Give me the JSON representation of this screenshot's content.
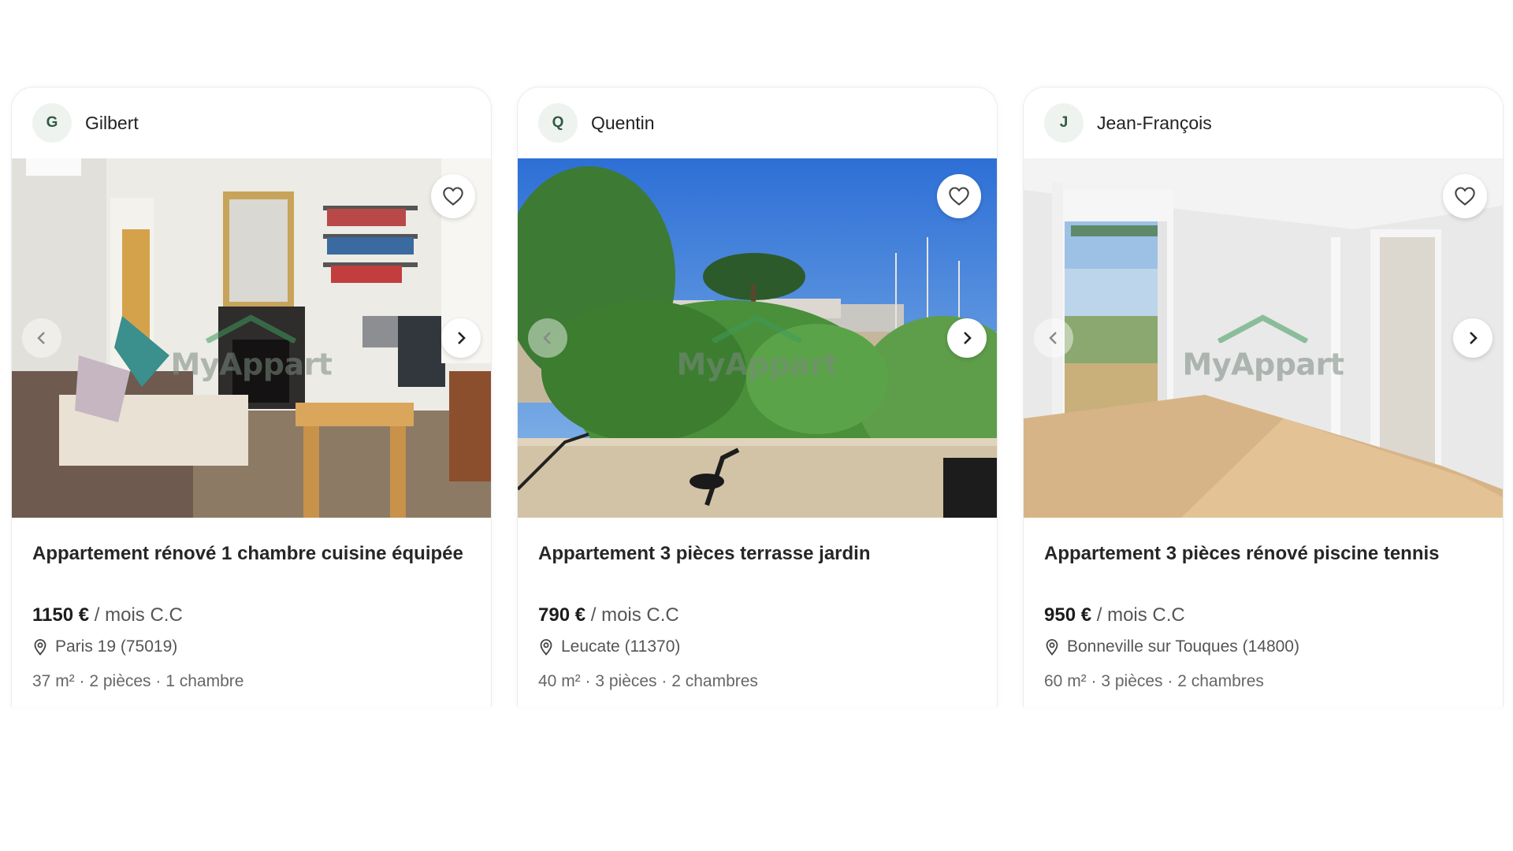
{
  "listings": [
    {
      "owner_initial": "G",
      "owner_name": "Gilbert",
      "title": "Appartement rénové 1 chambre cuisine équipée",
      "price": "1150 €",
      "price_suffix": "/ mois C.C",
      "location": "Paris 19 (75019)",
      "specs": "37 m² · 2 pièces · 1 chambre",
      "watermark": "MyAppart"
    },
    {
      "owner_initial": "Q",
      "owner_name": "Quentin",
      "title": "Appartement 3 pièces terrasse jardin",
      "price": "790 €",
      "price_suffix": "/ mois C.C",
      "location": "Leucate (11370)",
      "specs": "40 m² · 3 pièces · 2 chambres",
      "watermark": "MyAppart"
    },
    {
      "owner_initial": "J",
      "owner_name": "Jean-François",
      "title": "Appartement 3 pièces rénové piscine tennis",
      "price": "950 €",
      "price_suffix": "/ mois C.C",
      "location": "Bonneville sur Touques (14800)",
      "specs": "60 m² · 3 pièces · 2 chambres",
      "watermark": "MyAppart"
    }
  ],
  "icons": {
    "favorite": "heart-outline-icon",
    "previous": "chevron-left-icon",
    "next": "chevron-right-icon",
    "location": "map-pin-icon"
  },
  "colors": {
    "avatar_bg": "#eef3ef",
    "avatar_text": "#2e5b45",
    "watermark_green": "#3f9a5b"
  }
}
